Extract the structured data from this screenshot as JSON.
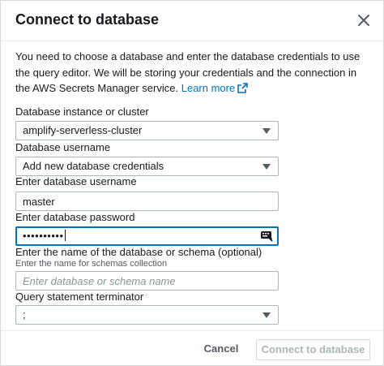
{
  "dialog": {
    "title": "Connect to database",
    "intro": "You need to choose a database and enter the database credentials to use the query editor. We will be storing your credentials and the connection in the AWS Secrets Manager service.",
    "learn_more": "Learn more",
    "icons": {
      "close": "close-icon",
      "external": "external-link-icon",
      "key": "key-icon",
      "dropdown": "caret-down-icon"
    }
  },
  "form": {
    "instance": {
      "label": "Database instance or cluster",
      "value": "amplify-serverless-cluster"
    },
    "username_select": {
      "label": "Database username",
      "value": "Add new database credentials"
    },
    "username_input": {
      "label": "Enter database username",
      "value": "master"
    },
    "password": {
      "label": "Enter database password",
      "masked": "••••••••••"
    },
    "database_name": {
      "label": "Enter the name of the database or schema (optional)",
      "description": "Enter the name for schemas collection",
      "placeholder": "Enter database or schema name"
    },
    "terminator": {
      "label": "Query statement terminator",
      "value": ";"
    }
  },
  "footer": {
    "cancel": "Cancel",
    "connect": "Connect to database"
  },
  "colors": {
    "link": "#0073bb",
    "focus": "#0073bb",
    "disabled_text": "#aab7b8"
  }
}
